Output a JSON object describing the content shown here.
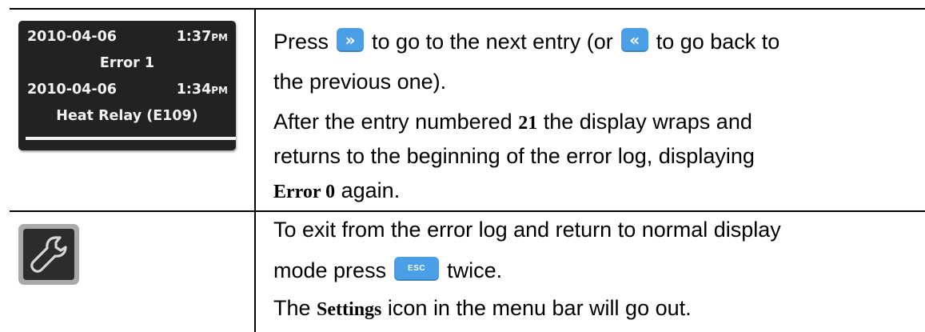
{
  "display": {
    "line1_date": "2010-04-06",
    "line1_time": "1:37",
    "line1_ampm": "PM",
    "line2": "Error 1",
    "line3_date": "2010-04-06",
    "line3_time": "1:34",
    "line3_ampm": "PM",
    "line4": "Heat Relay (E109)"
  },
  "row1": {
    "p1_a": "Press",
    "next_button_glyph": "»",
    "p1_b": "to go to the next entry (or",
    "prev_button_glyph": "«",
    "p1_c": "to go back to",
    "p2": "the previous one).",
    "p3_a": "After the entry numbered",
    "p3_num": "21",
    "p3_b": "the display wraps and",
    "p4": "returns to the beginning of the error log, displaying",
    "p5_term": "Error 0",
    "p5_b": "again."
  },
  "row2": {
    "icon": "wrench-icon",
    "p1": "To exit from the error log and return to normal display",
    "p2_a": "mode press",
    "esc_label": "ESC",
    "p2_b": "twice.",
    "p3_a": "The",
    "p3_term": "Settings",
    "p3_b": "icon in the menu bar will go out."
  },
  "colors": {
    "button_blue": "#4a9fe6",
    "lcd_background": "#222222",
    "icon_frame": "#a9a9a9"
  }
}
